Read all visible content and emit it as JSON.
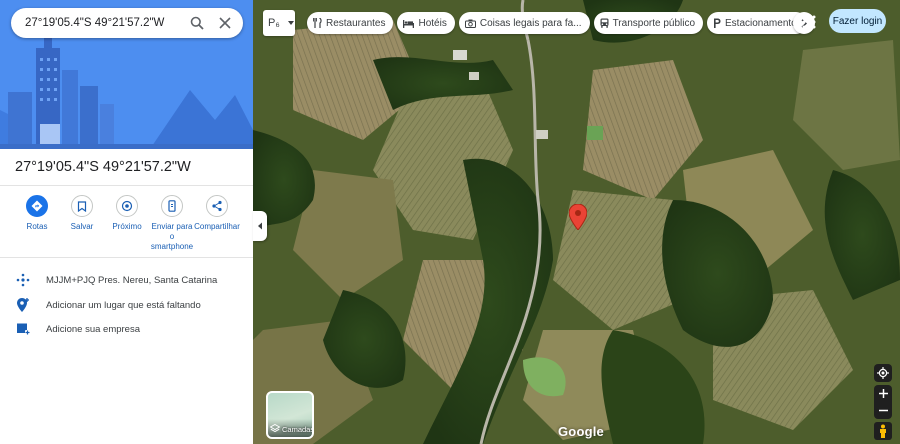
{
  "search": {
    "query": "27°19'05.4\"S 49°21'57.2\"W",
    "search_icon": "search-icon",
    "close_icon": "close-icon"
  },
  "place": {
    "title": "27°19'05.4\"S 49°21'57.2\"W"
  },
  "actions": [
    {
      "label": "Rotas",
      "icon": "directions-icon"
    },
    {
      "label": "Salvar",
      "icon": "bookmark-icon"
    },
    {
      "label": "Próximo",
      "icon": "nearby-icon"
    },
    {
      "label": "Enviar para o smartphone",
      "icon": "phone-icon"
    },
    {
      "label": "Compartilhar",
      "icon": "share-icon"
    }
  ],
  "info": [
    {
      "text": "MJJM+PJQ Pres. Nereu, Santa Catarina",
      "icon": "plus-code-icon"
    },
    {
      "text": "Adicionar um lugar que está faltando",
      "icon": "add-place-icon"
    },
    {
      "text": "Adicione sua empresa",
      "icon": "add-business-icon"
    }
  ],
  "map": {
    "peg_label": "P₆",
    "chips": [
      {
        "label": "Restaurantes",
        "icon": "restaurant-icon"
      },
      {
        "label": "Hotéis",
        "icon": "hotel-icon"
      },
      {
        "label": "Coisas legais para fa...",
        "icon": "camera-icon"
      },
      {
        "label": "Transporte público",
        "icon": "transit-icon"
      },
      {
        "label": "Estacionamento",
        "icon": "parking-icon"
      }
    ],
    "login_label": "Fazer login",
    "layers_label": "Camadas",
    "brand": "Google"
  },
  "colors": {
    "accent": "#1a73e8",
    "pin": "#ea4335",
    "login_bg": "#c2e7ff"
  }
}
